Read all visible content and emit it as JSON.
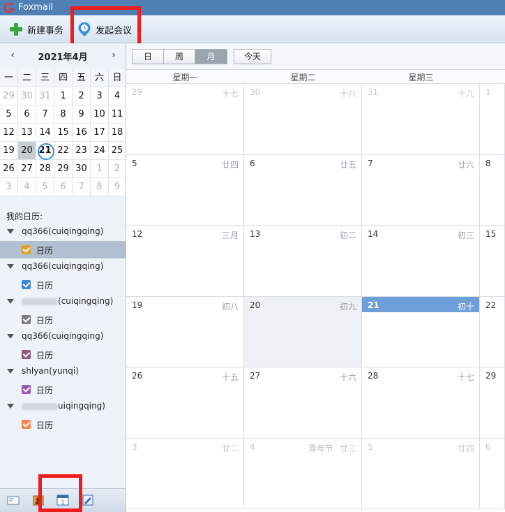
{
  "app": {
    "title": "Foxmail"
  },
  "toolbar": {
    "new_event": "新建事务",
    "start_meeting": "发起会议"
  },
  "mini": {
    "title": "2021年4月",
    "weekdays": [
      "一",
      "二",
      "三",
      "四",
      "五",
      "六",
      "日"
    ],
    "rows": [
      [
        "29",
        "30",
        "31",
        "1",
        "2",
        "3",
        "4"
      ],
      [
        "5",
        "6",
        "7",
        "8",
        "9",
        "10",
        "11"
      ],
      [
        "12",
        "13",
        "14",
        "15",
        "16",
        "17",
        "18"
      ],
      [
        "19",
        "20",
        "21",
        "22",
        "23",
        "24",
        "25"
      ],
      [
        "26",
        "27",
        "28",
        "29",
        "30",
        "1",
        "2"
      ],
      [
        "3",
        "4",
        "5",
        "6",
        "7",
        "8",
        "9"
      ]
    ]
  },
  "sidebar": {
    "my_calendars": "我的日历:",
    "accounts": [
      {
        "name": "qq366(cuiqingqing)",
        "calendar": "日历",
        "color": "#e0a12c"
      },
      {
        "name": "qq366(cuiqingqing)",
        "calendar": "日历",
        "color": "#3b86d8"
      },
      {
        "name": "(cuiqingqing)",
        "calendar": "日历",
        "color": "#7f7f7f"
      },
      {
        "name": "qq366(cuiqingqing)",
        "calendar": "日历",
        "color": "#8c5a7c"
      },
      {
        "name": "shlyan(yunqi)",
        "calendar": "日历",
        "color": "#9b59b6"
      },
      {
        "name": "uiqingqing)",
        "calendar": "日历",
        "color": "#f0864f"
      }
    ]
  },
  "view": {
    "day": "日",
    "week": "周",
    "month": "月",
    "today": "今天"
  },
  "grid": {
    "weekdays": [
      "星期一",
      "星期二",
      "星期三"
    ],
    "weeks": [
      [
        {
          "d": "29",
          "l": "十七"
        },
        {
          "d": "30",
          "l": "十八"
        },
        {
          "d": "31",
          "l": "十九"
        },
        {
          "d": "1"
        }
      ],
      [
        {
          "d": "5",
          "l": "廿四"
        },
        {
          "d": "6",
          "l": "廿五"
        },
        {
          "d": "7",
          "l": "廿六"
        },
        {
          "d": "8"
        }
      ],
      [
        {
          "d": "12",
          "l": "三月"
        },
        {
          "d": "13",
          "l": "初二"
        },
        {
          "d": "14",
          "l": "初三"
        },
        {
          "d": "15"
        }
      ],
      [
        {
          "d": "19",
          "l": "初八"
        },
        {
          "d": "20",
          "l": "初九"
        },
        {
          "d": "21",
          "l": "初十"
        },
        {
          "d": "22"
        }
      ],
      [
        {
          "d": "26",
          "l": "十五"
        },
        {
          "d": "27",
          "l": "十六"
        },
        {
          "d": "28",
          "l": "十七"
        },
        {
          "d": "29"
        }
      ],
      [
        {
          "d": "3",
          "l": "廿二"
        },
        {
          "d": "4",
          "l": "廿三",
          "f": "青年节"
        },
        {
          "d": "5",
          "l": "廿四"
        },
        {
          "d": "6"
        }
      ]
    ]
  }
}
